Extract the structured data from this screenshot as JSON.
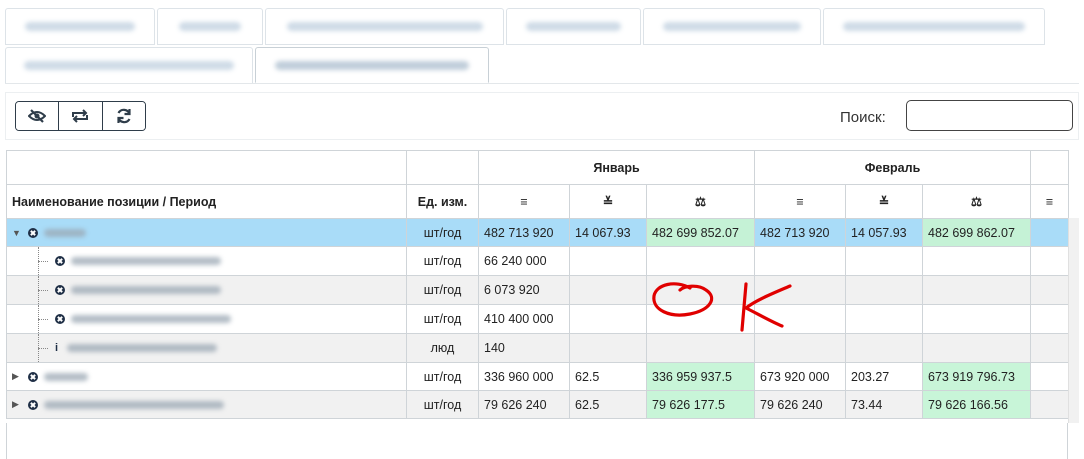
{
  "toolbar": {
    "search_label": "Поиск:",
    "search_value": "",
    "buttons": [
      "eye-slash-icon",
      "repeat-icon",
      "refresh-icon"
    ]
  },
  "table": {
    "col_name_header": "Наименование позиции / Период",
    "col_unit_header": "Ед. изм.",
    "months": [
      "Январь",
      "Февраль"
    ],
    "rows": [
      {
        "unit": "шт/год",
        "jan": [
          "482 713 920",
          "14 067.93",
          "482 699 852.07"
        ],
        "feb": [
          "482 713 920",
          "14 057.93",
          "482 699 862.07"
        ]
      },
      {
        "unit": "шт/год",
        "jan": [
          "66 240 000",
          "",
          ""
        ],
        "feb": [
          "",
          "",
          ""
        ]
      },
      {
        "unit": "шт/год",
        "jan": [
          "6 073 920",
          "",
          ""
        ],
        "feb": [
          "",
          "",
          ""
        ]
      },
      {
        "unit": "шт/год",
        "jan": [
          "410 400 000",
          "",
          ""
        ],
        "feb": [
          "",
          "",
          ""
        ]
      },
      {
        "unit": "люд",
        "jan": [
          "140",
          "",
          ""
        ],
        "feb": [
          "",
          "",
          ""
        ]
      },
      {
        "unit": "шт/год",
        "jan": [
          "336 960 000",
          "62.5",
          "336 959 937.5"
        ],
        "feb": [
          "673 920 000",
          "203.27",
          "673 919 796.73"
        ]
      },
      {
        "unit": "шт/год",
        "jan": [
          "79 626 240",
          "62.5",
          "79 626 177.5"
        ],
        "feb": [
          "79 626 240",
          "73.44",
          "79 626 166.56"
        ]
      }
    ]
  },
  "annotation": {
    "color": "#e00000"
  }
}
